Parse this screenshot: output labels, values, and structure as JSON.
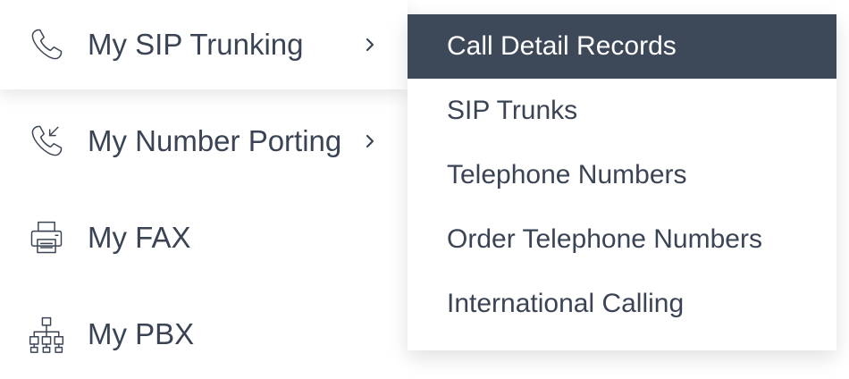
{
  "main_menu": {
    "items": [
      {
        "label": "My SIP Trunking",
        "icon": "phone-icon",
        "has_submenu": true,
        "active": true
      },
      {
        "label": "My Number Porting",
        "icon": "phone-incoming-icon",
        "has_submenu": true,
        "active": false
      },
      {
        "label": "My FAX",
        "icon": "fax-printer-icon",
        "has_submenu": false,
        "active": false
      },
      {
        "label": "My PBX",
        "icon": "org-chart-icon",
        "has_submenu": false,
        "active": false
      }
    ]
  },
  "submenu": {
    "items": [
      {
        "label": "Call Detail Records",
        "highlighted": true
      },
      {
        "label": "SIP Trunks",
        "highlighted": false
      },
      {
        "label": "Telephone Numbers",
        "highlighted": false
      },
      {
        "label": "Order Telephone Numbers",
        "highlighted": false
      },
      {
        "label": "International Calling",
        "highlighted": false
      }
    ]
  },
  "colors": {
    "text": "#3b4454",
    "highlight_background": "#3d4859",
    "highlight_text": "#ffffff",
    "background": "#ffffff"
  }
}
